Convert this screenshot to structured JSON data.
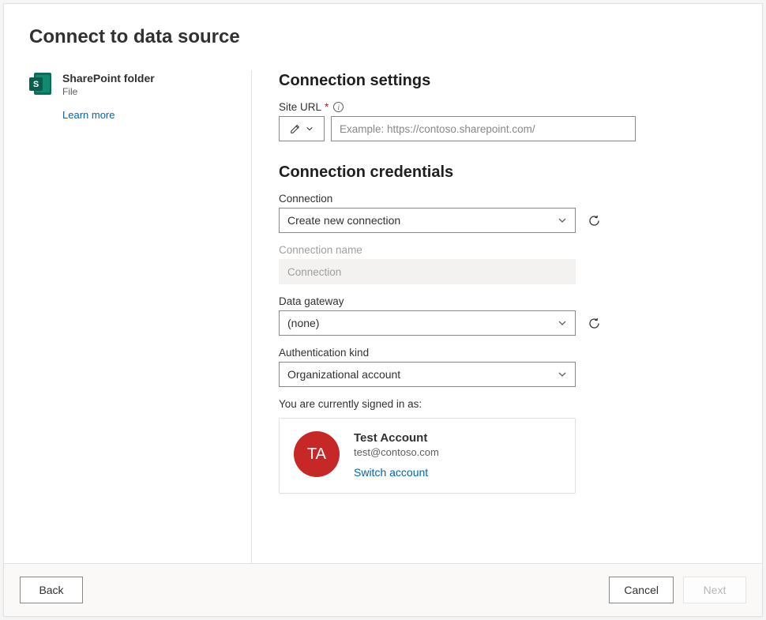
{
  "title": "Connect to data source",
  "source": {
    "name": "SharePoint folder",
    "subtitle": "File",
    "icon_letter": "S",
    "learn_more": "Learn more"
  },
  "settings": {
    "heading": "Connection settings",
    "site_url_label": "Site URL",
    "site_url_required": "*",
    "site_url_placeholder": "Example: https://contoso.sharepoint.com/"
  },
  "credentials": {
    "heading": "Connection credentials",
    "connection_label": "Connection",
    "connection_value": "Create new connection",
    "connection_name_label": "Connection name",
    "connection_name_placeholder": "Connection",
    "gateway_label": "Data gateway",
    "gateway_value": "(none)",
    "auth_label": "Authentication kind",
    "auth_value": "Organizational account",
    "signed_in_label": "You are currently signed in as:",
    "account_initials": "TA",
    "account_name": "Test Account",
    "account_email": "test@contoso.com",
    "switch_account": "Switch account"
  },
  "footer": {
    "back": "Back",
    "cancel": "Cancel",
    "next": "Next"
  }
}
